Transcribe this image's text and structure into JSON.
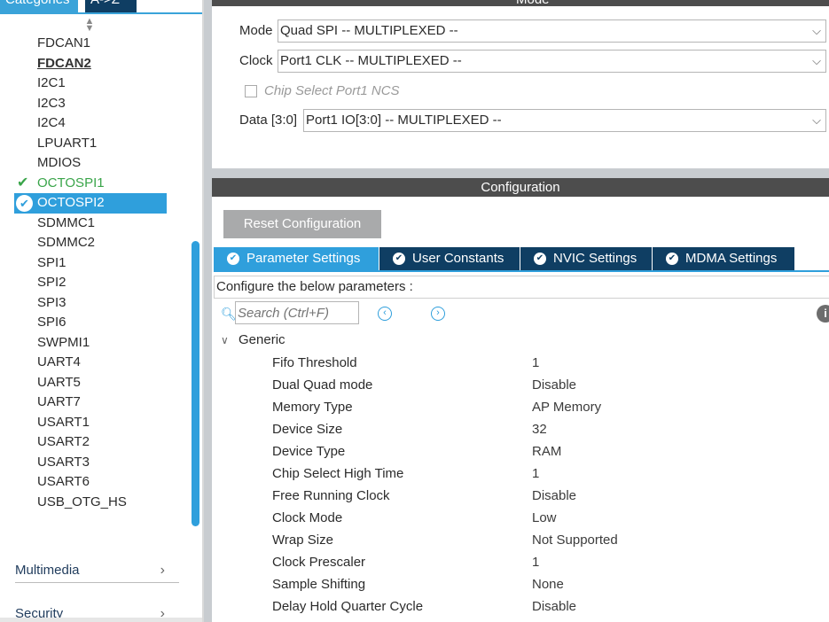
{
  "left_panel": {
    "tabs": {
      "categories": "Categories",
      "az": "A->Z"
    },
    "items": [
      {
        "label": "FDCAN1",
        "state": "normal"
      },
      {
        "label": "FDCAN2",
        "state": "bold"
      },
      {
        "label": "I2C1",
        "state": "normal"
      },
      {
        "label": "I2C3",
        "state": "normal"
      },
      {
        "label": "I2C4",
        "state": "normal"
      },
      {
        "label": "LPUART1",
        "state": "normal"
      },
      {
        "label": "MDIOS",
        "state": "normal"
      },
      {
        "label": "OCTOSPI1",
        "state": "green"
      },
      {
        "label": "OCTOSPI2",
        "state": "selected"
      },
      {
        "label": "SDMMC1",
        "state": "normal"
      },
      {
        "label": "SDMMC2",
        "state": "normal"
      },
      {
        "label": "SPI1",
        "state": "normal"
      },
      {
        "label": "SPI2",
        "state": "normal"
      },
      {
        "label": "SPI3",
        "state": "normal"
      },
      {
        "label": "SPI6",
        "state": "normal"
      },
      {
        "label": "SWPMI1",
        "state": "normal"
      },
      {
        "label": "UART4",
        "state": "normal"
      },
      {
        "label": "UART5",
        "state": "normal"
      },
      {
        "label": "UART7",
        "state": "normal"
      },
      {
        "label": "USART1",
        "state": "normal"
      },
      {
        "label": "USART2",
        "state": "normal"
      },
      {
        "label": "USART3",
        "state": "normal"
      },
      {
        "label": "USART6",
        "state": "normal"
      },
      {
        "label": "USB_OTG_HS",
        "state": "normal"
      }
    ],
    "groups": {
      "multimedia": "Multimedia",
      "security": "Security"
    },
    "check_glyph": "✔"
  },
  "mode": {
    "header": "Mode",
    "mode_label": "Mode",
    "mode_value": "Quad SPI -- MULTIPLEXED --",
    "clock_label": "Clock",
    "clock_value": "Port1 CLK -- MULTIPLEXED --",
    "chip_select_label": "Chip Select Port1 NCS",
    "data_label": "Data [3:0]",
    "data_value": "Port1 IO[3:0] -- MULTIPLEXED --"
  },
  "configuration": {
    "header": "Configuration",
    "reset_button": "Reset Configuration",
    "tabs": [
      {
        "label": "Parameter Settings",
        "active": true
      },
      {
        "label": "User Constants",
        "active": false
      },
      {
        "label": "NVIC Settings",
        "active": false
      },
      {
        "label": "MDMA Settings",
        "active": false
      }
    ],
    "configure_text": "Configure the below parameters :",
    "search_placeholder": "Search (Ctrl+F)",
    "group": "Generic",
    "params": [
      {
        "name": "Fifo Threshold",
        "value": "1"
      },
      {
        "name": "Dual Quad mode",
        "value": "Disable"
      },
      {
        "name": "Memory Type",
        "value": "AP Memory"
      },
      {
        "name": "Device Size",
        "value": "32"
      },
      {
        "name": "Device Type",
        "value": "RAM"
      },
      {
        "name": "Chip Select High Time",
        "value": "1"
      },
      {
        "name": "Free Running Clock",
        "value": "Disable"
      },
      {
        "name": "Clock Mode",
        "value": "Low"
      },
      {
        "name": "Wrap Size",
        "value": "Not Supported"
      },
      {
        "name": "Clock Prescaler",
        "value": "1"
      },
      {
        "name": "Sample Shifting",
        "value": "None"
      },
      {
        "name": "Delay Hold Quarter Cycle",
        "value": "Disable"
      }
    ]
  },
  "colors": {
    "accent": "#2f9fdc",
    "dark_tab": "#0f3e63",
    "header_bar": "#4d4d4d",
    "ok_green": "#3aa54a",
    "reset_button": "#a9aaab"
  }
}
